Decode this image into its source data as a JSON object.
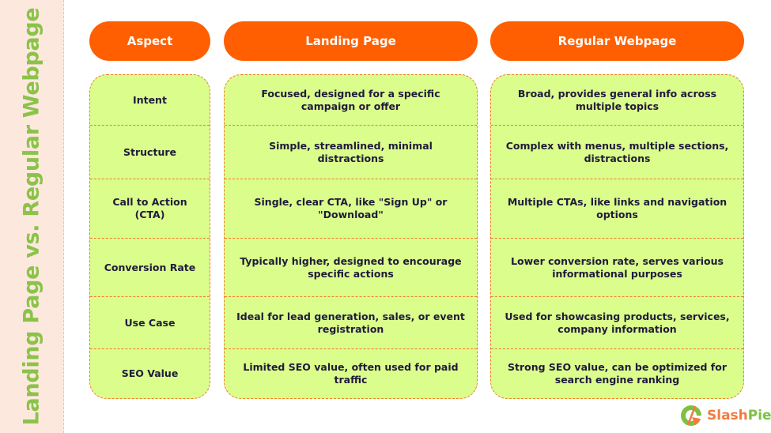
{
  "side_title": "Landing Page vs. Regular Webpage",
  "headers": {
    "aspect": "Aspect",
    "landing": "Landing Page",
    "regular": "Regular Webpage"
  },
  "rows": [
    {
      "aspect": "Intent",
      "landing": "Focused, designed for a specific campaign or offer",
      "regular": "Broad, provides general info across multiple topics"
    },
    {
      "aspect": "Structure",
      "landing": "Simple, streamlined, minimal distractions",
      "regular": "Complex with menus, multiple sections, distractions"
    },
    {
      "aspect": "Call to Action (CTA)",
      "landing": "Single, clear CTA, like \"Sign Up\" or \"Download\"",
      "regular": "Multiple CTAs, like links and navigation options"
    },
    {
      "aspect": "Conversion Rate",
      "landing": "Typically higher, designed to encourage specific actions",
      "regular": "Lower conversion rate, serves various informational purposes"
    },
    {
      "aspect": "Use Case",
      "landing": "Ideal for lead generation, sales, or event registration",
      "regular": "Used for showcasing products, services, company information"
    },
    {
      "aspect": "SEO Value",
      "landing": "Limited SEO value, often used for paid traffic",
      "regular": "Strong SEO value, can be optimized for search engine ranking"
    }
  ],
  "logo": {
    "part1": "Slash",
    "part2": "Pie",
    "icon": "slashpie-logo-icon"
  },
  "colors": {
    "accent": "#ff5f00",
    "cell_bg": "#dbfd8c",
    "title_green": "#8bc34a",
    "band_bg": "#fde8de"
  }
}
